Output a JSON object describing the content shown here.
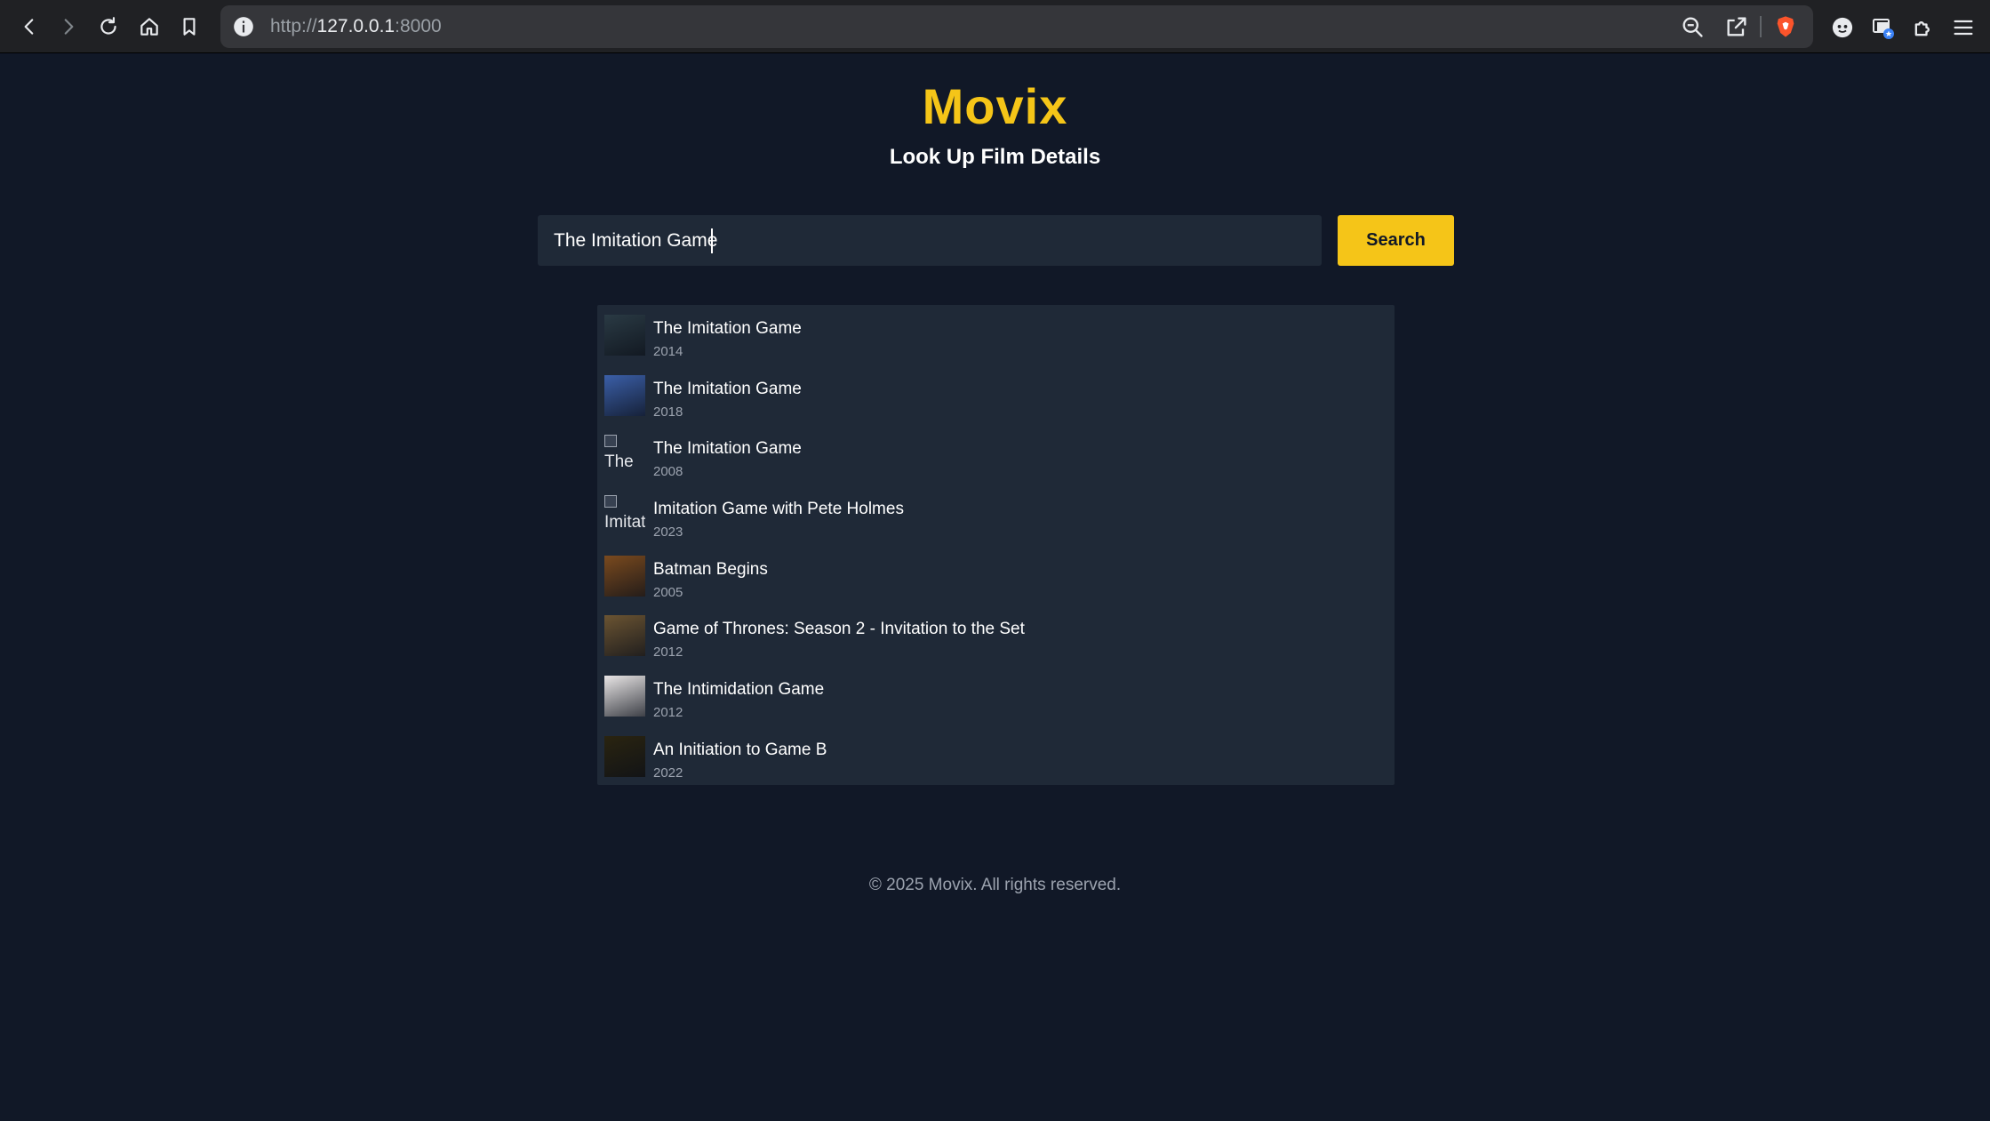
{
  "browser": {
    "url_scheme": "http://",
    "url_host": "127.0.0.1",
    "url_port": ":8000",
    "icons": [
      "back-icon",
      "forward-icon",
      "reload-icon",
      "home-icon",
      "bookmark-icon",
      "site-info-icon",
      "zoom-icon",
      "share-icon",
      "brave-shields-icon",
      "leo-icon",
      "wallet-icon",
      "extensions-icon",
      "menu-icon"
    ]
  },
  "header": {
    "brand": "Movix",
    "subtitle": "Look Up Film Details"
  },
  "search": {
    "value": "The Imitation Game",
    "button_label": "Search"
  },
  "results": [
    {
      "title": "The Imitation Game",
      "year": "2014",
      "poster": "image",
      "color": "#2a3a44"
    },
    {
      "title": "The Imitation Game",
      "year": "2018",
      "poster": "image",
      "color": "#3b5fa8"
    },
    {
      "title": "The Imitation Game",
      "year": "2008",
      "poster": "broken",
      "alt": "The"
    },
    {
      "title": "Imitation Game with Pete Holmes",
      "year": "2023",
      "poster": "broken",
      "alt": "Imitat"
    },
    {
      "title": "Batman Begins",
      "year": "2005",
      "poster": "image",
      "color": "#7a4a1e"
    },
    {
      "title": "Game of Thrones: Season 2 - Invitation to the Set",
      "year": "2012",
      "poster": "image",
      "color": "#6b5432"
    },
    {
      "title": "The Intimidation Game",
      "year": "2012",
      "poster": "image",
      "color": "#e9e6e6"
    },
    {
      "title": "An Initiation to Game B",
      "year": "2022",
      "poster": "image",
      "color": "#2a2410"
    }
  ],
  "footer": {
    "text": "© 2025 Movix. All rights reserved."
  },
  "colors": {
    "accent": "#f5c518",
    "background": "#111827",
    "panel": "#1f2937"
  }
}
